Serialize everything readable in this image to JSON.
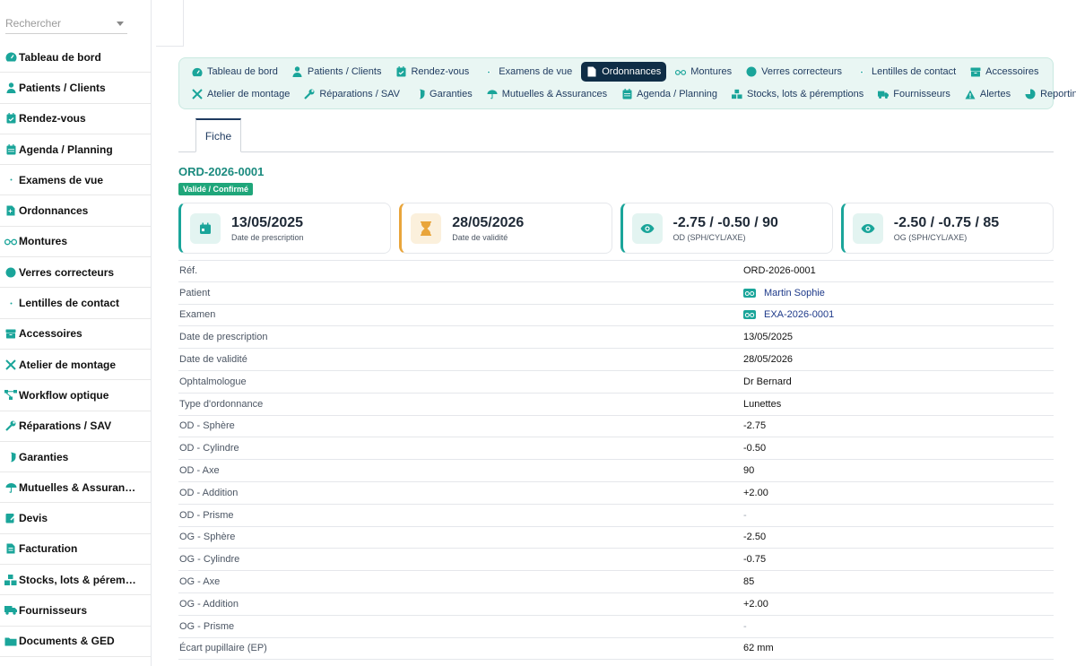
{
  "sidebar": {
    "search_placeholder": "Rechercher",
    "items": [
      {
        "label": "Tableau de bord",
        "icon": "gauge-icon"
      },
      {
        "label": "Patients / Clients",
        "icon": "user-icon"
      },
      {
        "label": "Rendez-vous",
        "icon": "calendar-check-icon"
      },
      {
        "label": "Agenda / Planning",
        "icon": "calendar-icon"
      },
      {
        "label": "Examens de vue",
        "icon": "eye-icon"
      },
      {
        "label": "Ordonnances",
        "icon": "file-icon"
      },
      {
        "label": "Montures",
        "icon": "glasses-icon"
      },
      {
        "label": "Verres correcteurs",
        "icon": "circle-icon"
      },
      {
        "label": "Lentilles de contact",
        "icon": "eye-icon"
      },
      {
        "label": "Accessoires",
        "icon": "box-icon"
      },
      {
        "label": "Atelier de montage",
        "icon": "tools-icon"
      },
      {
        "label": "Workflow optique",
        "icon": "workflow-icon"
      },
      {
        "label": "Réparations / SAV",
        "icon": "wrench-icon"
      },
      {
        "label": "Garanties",
        "icon": "shield-icon"
      },
      {
        "label": "Mutuelles & Assuran…",
        "icon": "umbrella-icon"
      },
      {
        "label": "Devis",
        "icon": "edit-icon"
      },
      {
        "label": "Facturation",
        "icon": "invoice-icon"
      },
      {
        "label": "Stocks, lots & pérem…",
        "icon": "boxes-icon"
      },
      {
        "label": "Fournisseurs",
        "icon": "truck-icon"
      },
      {
        "label": "Documents & GED",
        "icon": "folder-icon"
      }
    ]
  },
  "nav": {
    "row1": [
      {
        "label": "Tableau de bord",
        "icon": "gauge-icon"
      },
      {
        "label": "Patients / Clients",
        "icon": "user-icon"
      },
      {
        "label": "Rendez-vous",
        "icon": "calendar-check-icon"
      },
      {
        "label": "Examens de vue",
        "icon": "eye-icon"
      },
      {
        "label": "Ordonnances",
        "icon": "file-icon",
        "active": true
      },
      {
        "label": "Montures",
        "icon": "glasses-icon"
      },
      {
        "label": "Verres correcteurs",
        "icon": "circle-icon"
      },
      {
        "label": "Lentilles de contact",
        "icon": "eye-icon"
      },
      {
        "label": "Accessoires",
        "icon": "box-icon"
      }
    ],
    "row2": [
      {
        "label": "Atelier de montage",
        "icon": "tools-icon"
      },
      {
        "label": "Réparations / SAV",
        "icon": "wrench-icon"
      },
      {
        "label": "Garanties",
        "icon": "shield-icon"
      },
      {
        "label": "Mutuelles & Assurances",
        "icon": "umbrella-icon"
      },
      {
        "label": "Agenda / Planning",
        "icon": "calendar-icon"
      },
      {
        "label": "Stocks, lots & péremptions",
        "icon": "boxes-icon"
      },
      {
        "label": "Fournisseurs",
        "icon": "truck-icon"
      },
      {
        "label": "Alertes",
        "icon": "warning-icon"
      },
      {
        "label": "Reporting",
        "icon": "pie-icon"
      }
    ]
  },
  "tabs": {
    "fiche": "Fiche"
  },
  "record": {
    "id": "ORD-2026-0001",
    "status": "Validé / Confirmé"
  },
  "cards": [
    {
      "value": "13/05/2025",
      "label": "Date de prescription",
      "icon": "calendar-icon"
    },
    {
      "value": "28/05/2026",
      "label": "Date de validité",
      "icon": "hourglass-icon"
    },
    {
      "value": "-2.75 / -0.50 / 90",
      "label": "OD (SPH/CYL/AXE)",
      "icon": "eye-icon"
    },
    {
      "value": "-2.50 / -0.75 / 85",
      "label": "OG (SPH/CYL/AXE)",
      "icon": "eye-icon"
    }
  ],
  "details": [
    {
      "k": "Réf.",
      "v": "ORD-2026-0001"
    },
    {
      "k": "Patient",
      "v": "Martin Sophie",
      "link": true
    },
    {
      "k": "Examen",
      "v": "EXA-2026-0001",
      "link": true
    },
    {
      "k": "Date de prescription",
      "v": "13/05/2025"
    },
    {
      "k": "Date de validité",
      "v": "28/05/2026"
    },
    {
      "k": "Ophtalmologue",
      "v": "Dr Bernard"
    },
    {
      "k": "Type d'ordonnance",
      "v": "Lunettes"
    },
    {
      "k": "OD - Sphère",
      "v": "-2.75"
    },
    {
      "k": "OD - Cylindre",
      "v": "-0.50"
    },
    {
      "k": "OD - Axe",
      "v": "90"
    },
    {
      "k": "OD - Addition",
      "v": "+2.00"
    },
    {
      "k": "OD - Prisme",
      "v": "-",
      "muted": true
    },
    {
      "k": "OG - Sphère",
      "v": "-2.50"
    },
    {
      "k": "OG - Cylindre",
      "v": "-0.75"
    },
    {
      "k": "OG - Axe",
      "v": "85"
    },
    {
      "k": "OG - Addition",
      "v": "+2.00"
    },
    {
      "k": "OG - Prisme",
      "v": "-",
      "muted": true
    },
    {
      "k": "Écart pupillaire (EP)",
      "v": "62 mm"
    }
  ],
  "colors": {
    "teal": "#1aa59a",
    "navy": "#0f2d46",
    "orange": "#e9a53b",
    "green": "#1fa67a"
  }
}
